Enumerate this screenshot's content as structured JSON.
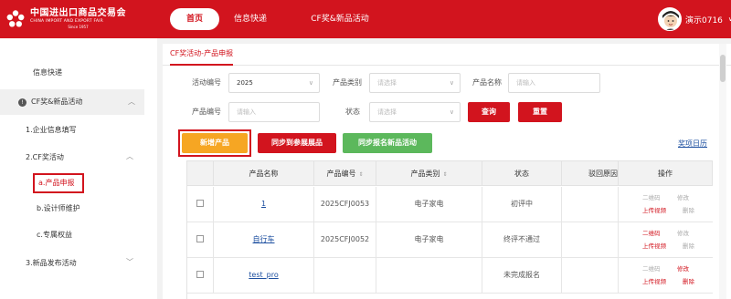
{
  "header": {
    "logo_cn": "中国进出口商品交易会",
    "logo_en": "CHINA IMPORT AND EXPORT FAIR",
    "logo_since": "Since 1957",
    "nav": [
      {
        "label": "首页",
        "active": true
      },
      {
        "label": "信息快递",
        "active": false
      },
      {
        "label": "CF奖&新品活动",
        "active": false
      }
    ],
    "user_name": "演示0716",
    "user_chevron": "∨"
  },
  "sidebar": {
    "info": "信息快递",
    "cf_section": "CF奖&新品活动",
    "cf_icon": "!",
    "items": [
      {
        "label": "1.企业信息填写"
      },
      {
        "label": "2.CF奖活动"
      },
      {
        "label": "a.产品申报",
        "active": true
      },
      {
        "label": "b.设计师维护"
      },
      {
        "label": "c.专属权益"
      },
      {
        "label": "3.新品发布活动"
      }
    ]
  },
  "main": {
    "tab": "CF奖活动-产品申报",
    "filters": {
      "activity_no_label": "活动编号",
      "activity_no_value": "2025",
      "category_label": "产品类别",
      "category_placeholder": "请选择",
      "name_label": "产品名称",
      "name_placeholder": "请输入",
      "code_label": "产品编号",
      "code_placeholder": "请输入",
      "status_label": "状态",
      "status_placeholder": "请选择",
      "query_button": "查询",
      "reset_button": "重置"
    },
    "actions": {
      "add_button": "新增产品",
      "sync_exhibit_button": "同步到参展展品",
      "sync_new_button": "同步报名新品活动",
      "award_calendar_link": "奖项日历"
    },
    "table": {
      "headers": [
        "产品名称",
        "产品编号",
        "产品类别",
        "状态",
        "驳回原因",
        "操作"
      ],
      "rows": [
        {
          "name": "1",
          "code": "2025CFJ0053",
          "category": "电子家电",
          "status": "初评中",
          "reason": "",
          "ops": {
            "qrcode": "二维码",
            "edit": "修改",
            "upload": "上传视频",
            "delete": "删除"
          }
        },
        {
          "name": "自行车",
          "code": "2025CFJ0052",
          "category": "电子家电",
          "status": "终评不通过",
          "reason": "",
          "ops": {
            "qrcode": "二维码",
            "edit": "修改",
            "upload": "上传视频",
            "delete": "删除"
          }
        },
        {
          "name": "test_pro",
          "code": "",
          "category": "",
          "status": "未完成报名",
          "reason": "",
          "ops": {
            "qrcode": "二维码",
            "edit": "修改",
            "upload": "上传视频",
            "delete": "删除"
          }
        }
      ]
    }
  },
  "colors": {
    "brand_red": "#d2141e",
    "orange": "#f6a623",
    "green": "#5cb85c",
    "link_blue": "#1e50a0"
  },
  "icons": [
    "logo-flower-icon",
    "avatar-icon",
    "chevron-down-icon",
    "info-circle-icon",
    "chevron-up-icon",
    "sort-icon",
    "dropdown-arrow-icon"
  ]
}
